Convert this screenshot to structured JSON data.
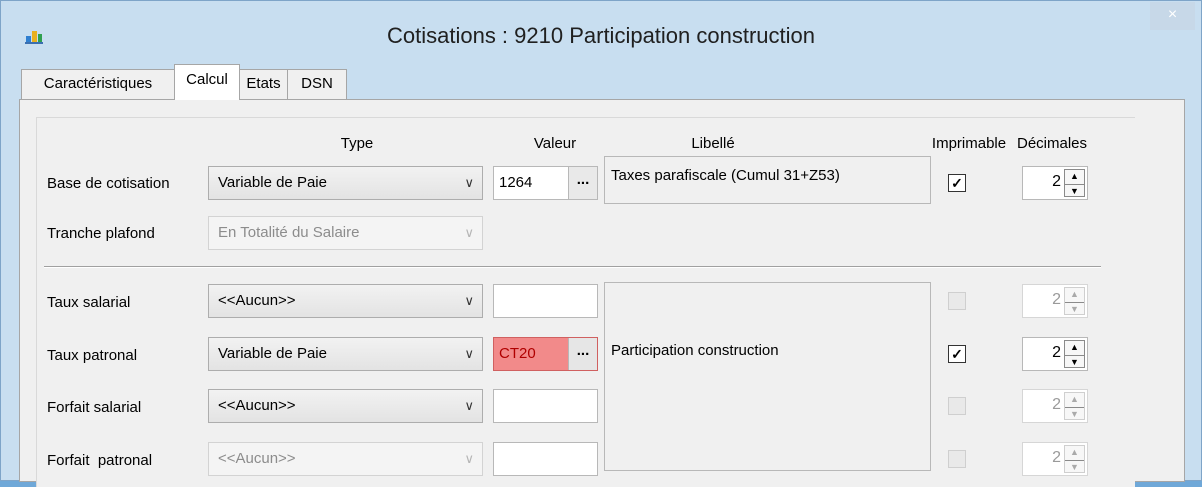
{
  "window": {
    "title": "Cotisations : 9210 Participation construction",
    "close_label": "×"
  },
  "tabs": [
    {
      "label": "Caractéristiques",
      "active": false
    },
    {
      "label": "Calcul",
      "active": true
    },
    {
      "label": "Etats",
      "active": false
    },
    {
      "label": "DSN",
      "active": false
    }
  ],
  "headers": {
    "type": "Type",
    "valeur": "Valeur",
    "libelle": "Libellé",
    "imprimable": "Imprimable",
    "decimales": "Décimales"
  },
  "rows": {
    "base": {
      "label": "Base de cotisation",
      "type": "Variable de Paie",
      "valeur": "1264",
      "libelle": "Taxes parafiscale (Cumul 31+Z53)",
      "imprimable": true,
      "decimales": "2"
    },
    "tranche": {
      "label": "Tranche plafond",
      "type": "En Totalité du Salaire"
    },
    "taux_salarial": {
      "label": "Taux salarial",
      "type": "<<Aucun>>",
      "valeur": "",
      "imprimable": false,
      "decimales": "2"
    },
    "taux_patronal": {
      "label": "Taux patronal",
      "type": "Variable de Paie",
      "valeur": "CT20",
      "imprimable": true,
      "decimales": "2"
    },
    "forfait_salarial": {
      "label": "Forfait salarial",
      "type": "<<Aucun>>",
      "valeur": "",
      "imprimable": false,
      "decimales": "2"
    },
    "forfait_patronal": {
      "label": "Forfait  patronal",
      "type": "<<Aucun>>",
      "valeur": "",
      "imprimable": false,
      "decimales": "2"
    }
  },
  "libelle_shared": "Participation construction",
  "icons": {
    "app": "app-logo-icon",
    "dropdown": "chevron-down-icon",
    "ellipsis": "ellipsis-button",
    "spin": "spinner-arrows-icon"
  },
  "colors": {
    "titlebar_bg": "#c8def0",
    "error_field": "#f28a8a"
  }
}
